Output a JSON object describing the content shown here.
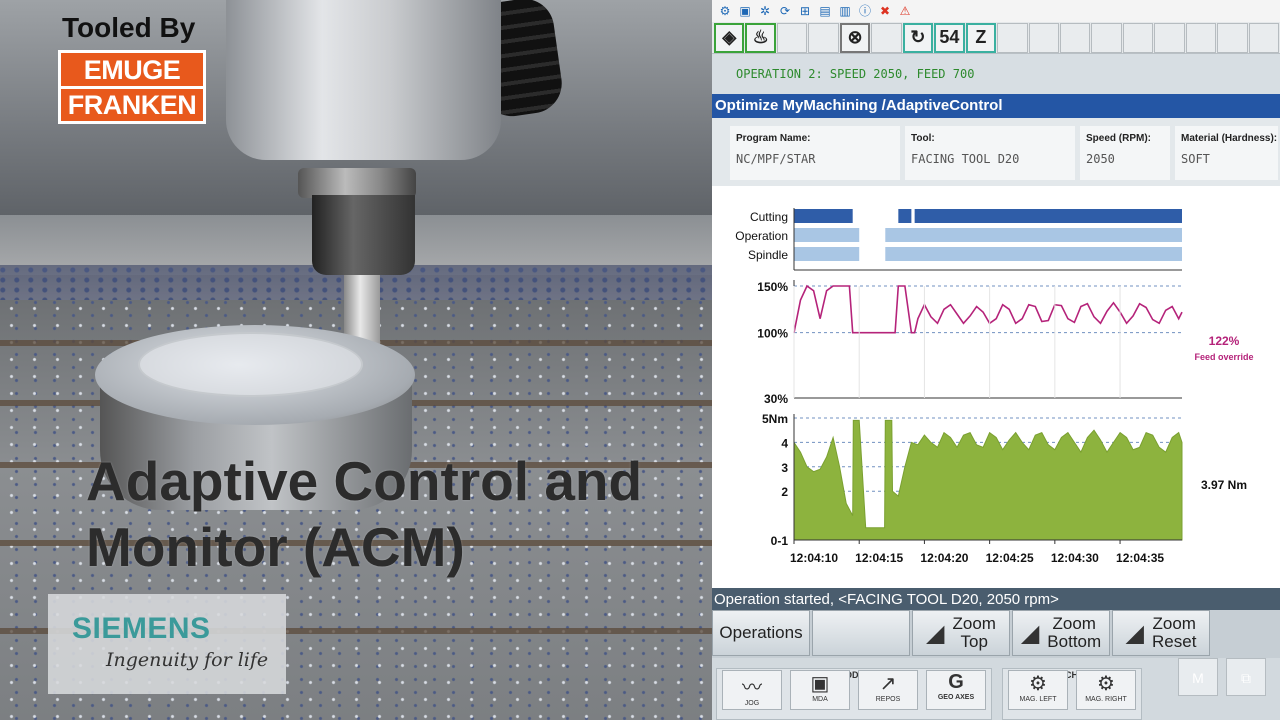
{
  "video": {
    "tooled_by": "Tooled By",
    "brand_line1": "EMUGE",
    "brand_line2": "FRANKEN",
    "headline_line1": "Adaptive Control and",
    "headline_line2": "Monitor (ACM)",
    "siemens_name": "SIEMENS",
    "siemens_tagline": "Ingenuity for life"
  },
  "toolbar": {
    "counter": "54",
    "axis": "Z"
  },
  "operation_banner": "OPERATION 2: SPEED 2050, FEED 700",
  "panel_title": "Optimize MyMachining /AdaptiveControl",
  "info": {
    "program_label": "Program Name:",
    "program_value": "NC/MPF/STAR",
    "tool_label": "Tool:",
    "tool_value": "FACING TOOL D20",
    "speed_label": "Speed (RPM):",
    "speed_value": "2050",
    "material_label": "Material (Hardness):",
    "material_value": "SOFT"
  },
  "status_line": "Operation started, <FACING TOOL D20, 2050 rpm>",
  "softkeys": {
    "operations": "Operations",
    "zoom_top_1": "Zoom",
    "zoom_top_2": "Top",
    "zoom_bottom_1": "Zoom",
    "zoom_bottom_2": "Bottom",
    "zoom_reset_1": "Zoom",
    "zoom_reset_2": "Reset"
  },
  "bottom": {
    "modes_label": "MODES",
    "machine_label": "MACHINE",
    "jog": "JOG",
    "mda": "MDA",
    "repos": "REPOS",
    "g_label": "G",
    "geo_axes": "GEO AXES",
    "mag_left": "MAG. LEFT",
    "mag_right": "MAG. RIGHT",
    "m_key": "M"
  },
  "chart_data": {
    "type": "line",
    "status_rows": {
      "labels": [
        "Cutting",
        "Operation",
        "Spindle"
      ],
      "cutting": [
        [
          0,
          9
        ],
        [
          16,
          18
        ],
        [
          18.5,
          59.5
        ]
      ],
      "operation": [
        [
          0,
          10
        ],
        [
          14,
          59.5
        ]
      ],
      "spindle": [
        [
          0,
          10
        ],
        [
          14,
          59.5
        ]
      ]
    },
    "feed_override": {
      "y_ticks": [
        "150%",
        "100%",
        "30%"
      ],
      "current_value": "122%",
      "current_label": "Feed override",
      "x": [
        0,
        1,
        2,
        3,
        4,
        5,
        6,
        7,
        8,
        8.5,
        9,
        12,
        15.5,
        16,
        16.5,
        17,
        18,
        18.5,
        19,
        20,
        21,
        22,
        23,
        24,
        25,
        26,
        27,
        28,
        29,
        30,
        31,
        32,
        33,
        34,
        35,
        36,
        37,
        38,
        39,
        40,
        41,
        42,
        43,
        44,
        45,
        46,
        47,
        48,
        49,
        50,
        51,
        52,
        53,
        54,
        55,
        56,
        57,
        58,
        59,
        59.5
      ],
      "y": [
        100,
        135,
        150,
        145,
        115,
        145,
        150,
        150,
        150,
        150,
        100,
        100,
        100,
        150,
        150,
        150,
        100,
        100,
        115,
        130,
        117,
        110,
        125,
        130,
        120,
        110,
        118,
        128,
        122,
        110,
        115,
        130,
        125,
        110,
        115,
        130,
        128,
        112,
        113,
        130,
        129,
        115,
        111,
        128,
        131,
        117,
        110,
        123,
        132,
        122,
        110,
        118,
        131,
        127,
        114,
        110,
        124,
        128,
        115,
        122
      ]
    },
    "torque": {
      "y_ticks": [
        "5Nm",
        "4",
        "3",
        "2",
        "0-1"
      ],
      "current_value": "3.97 Nm",
      "x": [
        0,
        1,
        2,
        3,
        4,
        5,
        6,
        7,
        8,
        9,
        9.1,
        10,
        11,
        13.9,
        14,
        15,
        15.1,
        16,
        17,
        18,
        19,
        20,
        21,
        22,
        23,
        24,
        25,
        26,
        27,
        28,
        29,
        30,
        31,
        32,
        33,
        34,
        35,
        36,
        37,
        38,
        39,
        40,
        41,
        42,
        43,
        44,
        45,
        46,
        47,
        48,
        49,
        50,
        51,
        52,
        53,
        54,
        55,
        56,
        57,
        58,
        59,
        59.5
      ],
      "y": [
        4.0,
        3.6,
        3.0,
        2.8,
        2.9,
        3.4,
        4.2,
        3.0,
        1.5,
        1.0,
        4.9,
        4.9,
        0.5,
        0.5,
        4.9,
        4.9,
        2.0,
        1.8,
        3.0,
        4.0,
        3.9,
        4.3,
        4.0,
        3.8,
        4.4,
        4.2,
        3.8,
        4.3,
        4.4,
        3.9,
        3.8,
        4.4,
        4.2,
        3.7,
        4.1,
        4.4,
        4.0,
        3.7,
        4.3,
        4.4,
        3.9,
        3.7,
        4.2,
        4.4,
        4.0,
        3.6,
        4.2,
        4.5,
        4.1,
        3.6,
        4.0,
        4.4,
        4.2,
        3.7,
        3.8,
        4.4,
        4.3,
        3.8,
        3.6,
        4.2,
        4.4,
        4.0
      ]
    },
    "x_ticks": [
      "12:04:10",
      "12:04:15",
      "12:04:20",
      "12:04:25",
      "12:04:30",
      "12:04:35"
    ],
    "x_tick_values": [
      0,
      10,
      20,
      30,
      40,
      50
    ],
    "colors": {
      "cutting": "#2f5da8",
      "operation": "#a9c6e4",
      "feed_line": "#b5237a",
      "torque_fill": "#8db33e",
      "grid": "#7090c0"
    }
  }
}
